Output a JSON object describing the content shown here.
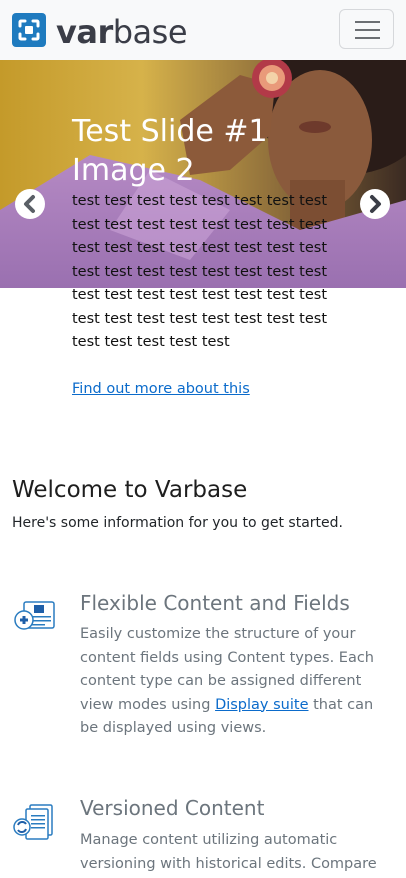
{
  "header": {
    "logo_var": "var",
    "logo_base": "base",
    "menu_icon": "hamburger-icon",
    "brand_color": "#1f7bbf"
  },
  "carousel": {
    "title": "Test Slide #1 Image 2",
    "body": "test test test test test test test test test test test test test test test test test test test test test test test test test test test test test test test test test test test test test test test test test test test test test test test test test test test test test",
    "link": "Find out more about this",
    "prev_icon": "chevron-left-icon",
    "next_icon": "chevron-right-icon"
  },
  "welcome": {
    "title": "Welcome to Varbase",
    "subtitle": "Here's some information for you to get started."
  },
  "features": [
    {
      "icon": "content-fields-icon",
      "title": "Flexible Content and Fields",
      "desc_before": "Easily customize the structure of your content fields using Content types. Each content type can be assigned different view modes using ",
      "desc_link": "Display suite",
      "desc_after": " that can be displayed using views."
    },
    {
      "icon": "versioned-content-icon",
      "title": "Versioned Content",
      "desc_before": "Manage content utilizing automatic versioning with historical edits. Compare",
      "desc_link": "",
      "desc_after": ""
    }
  ],
  "colors": {
    "link": "#0b6bcb",
    "muted_text": "#6c757d",
    "header_bg": "#f8f9fa"
  }
}
